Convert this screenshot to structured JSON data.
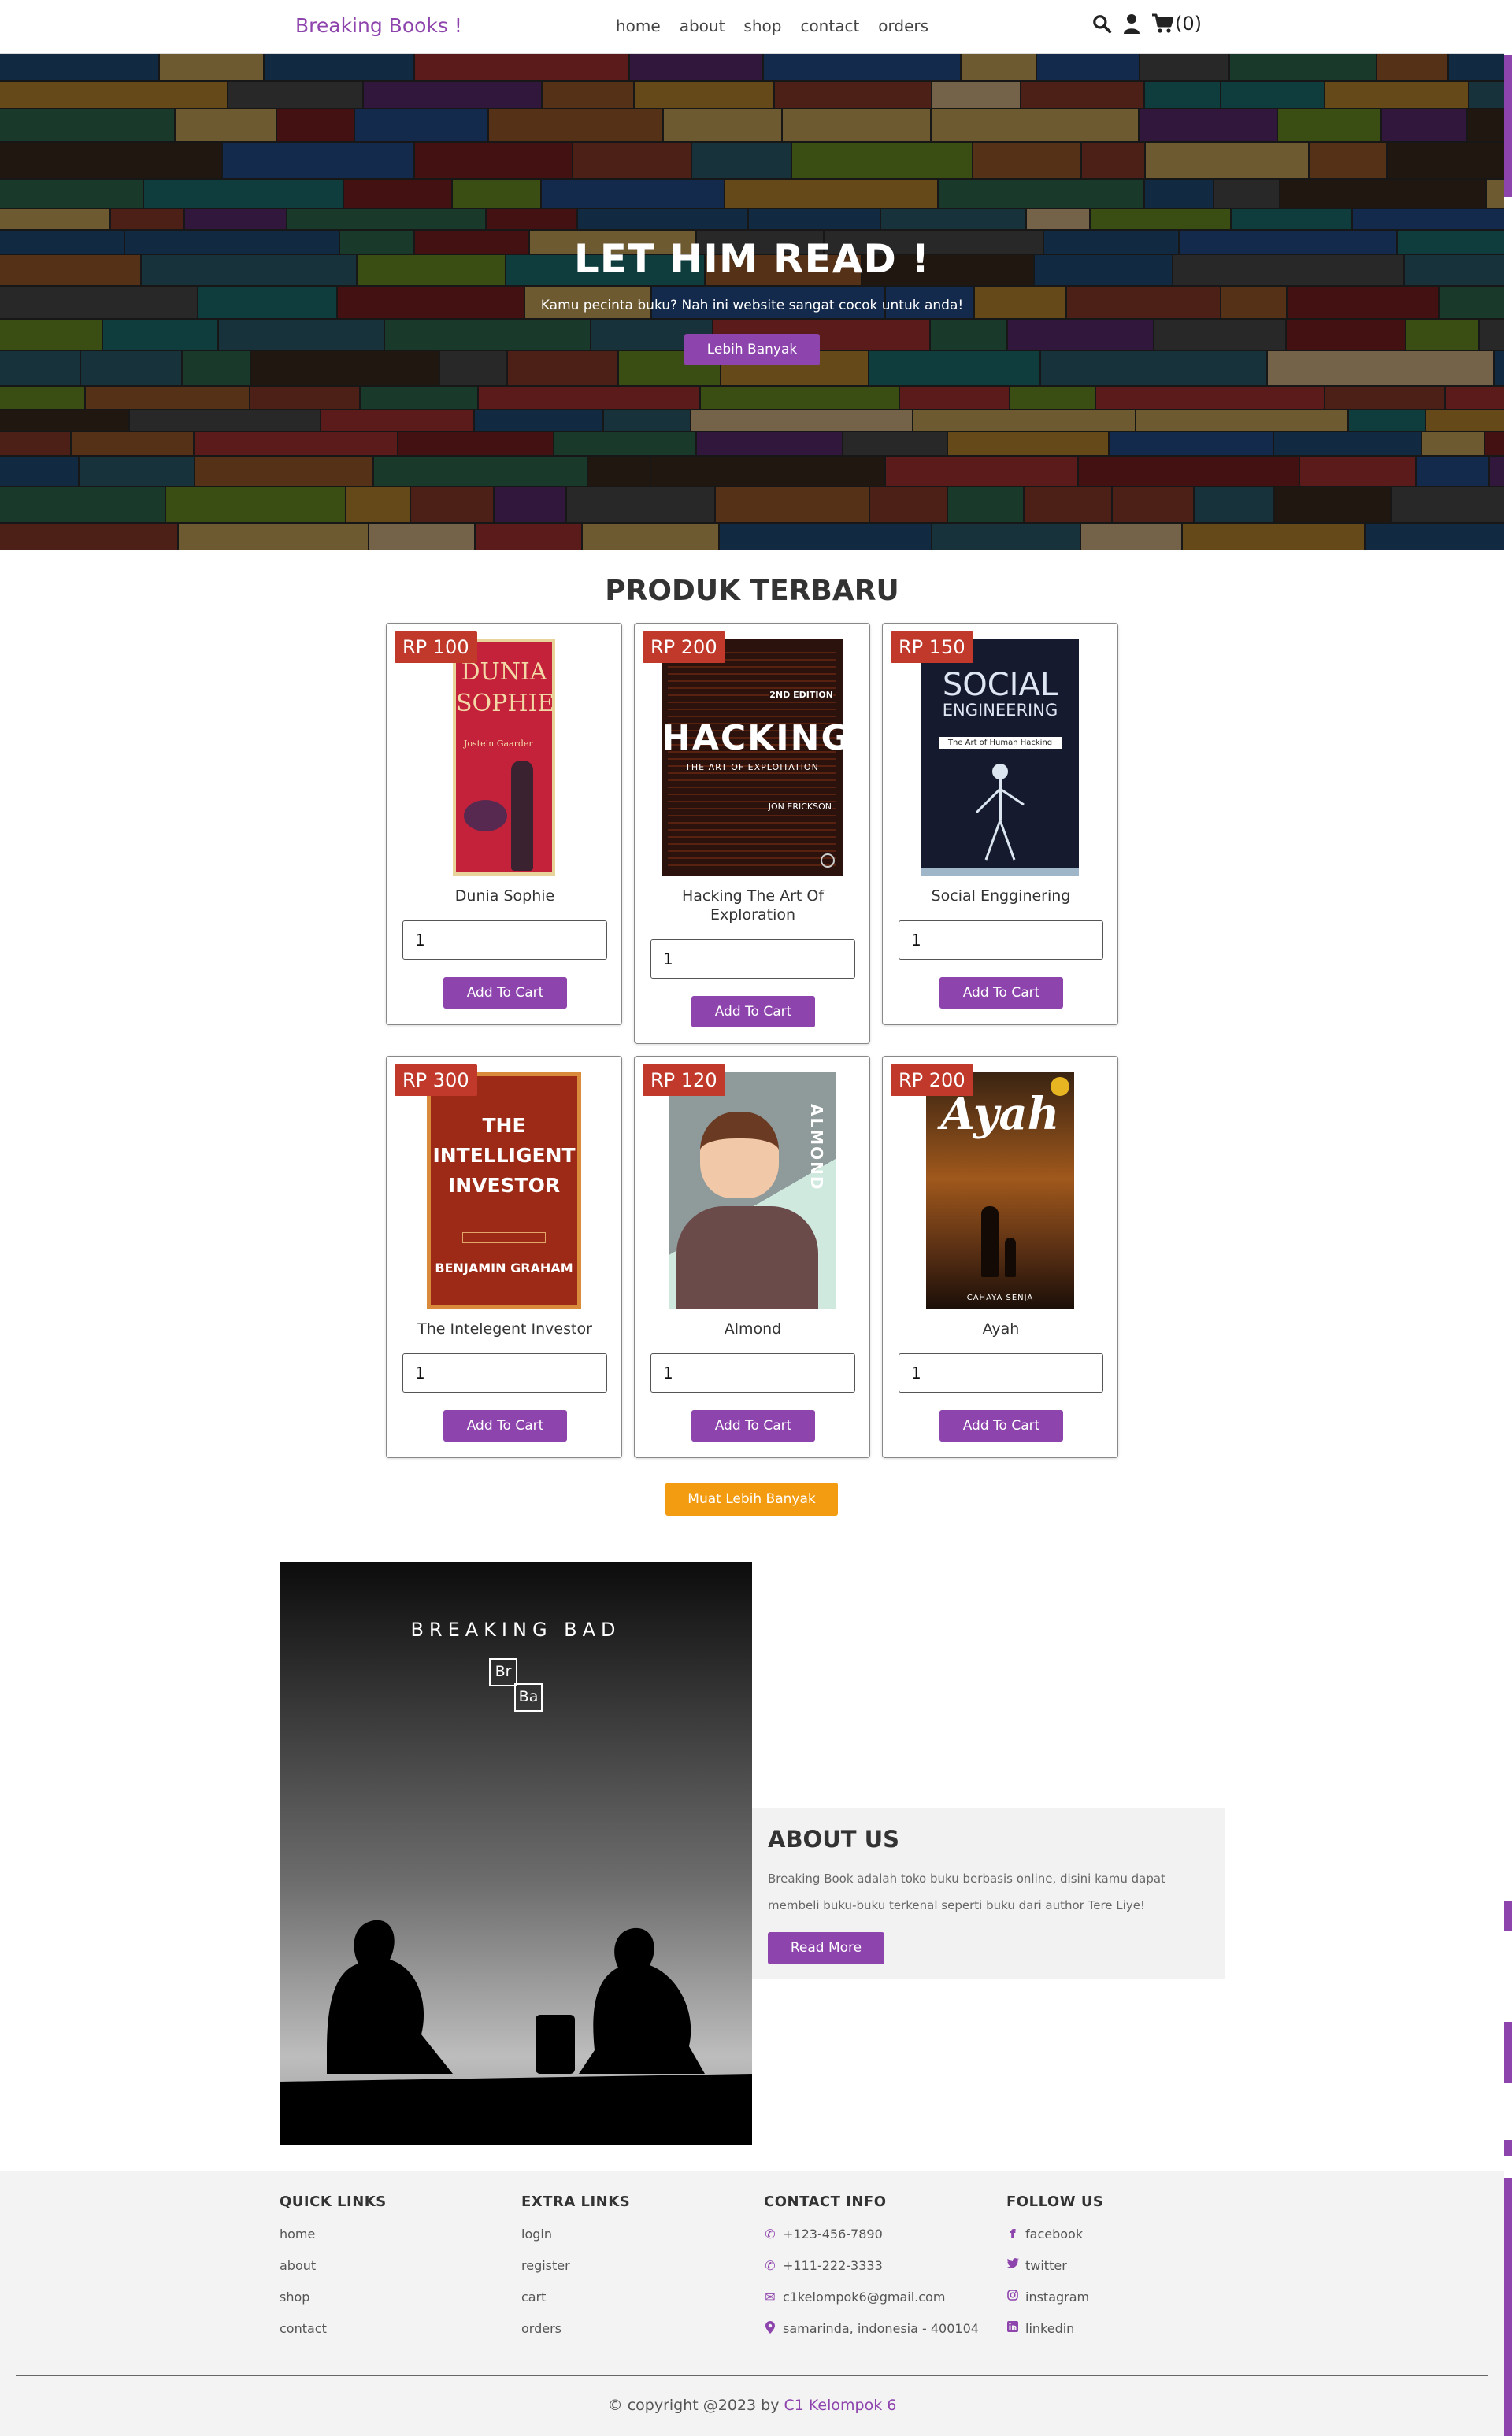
{
  "header": {
    "logo": "Breaking Books !",
    "nav": [
      "home",
      "about",
      "shop",
      "contact",
      "orders"
    ],
    "cart_count": "(0)"
  },
  "hero": {
    "title": "LET HIM READ !",
    "subtitle": "Kamu pecinta buku? Nah ini website sangat cocok untuk anda!",
    "button": "Lebih Banyak"
  },
  "products_section": {
    "title": "PRODUK TERBARU",
    "add_label": "Add To Cart",
    "items": [
      {
        "price": "RP 100",
        "name": "Dunia Sophie",
        "qty": "1",
        "cover": {
          "bg": "#c4213a",
          "lines": [
            "DUNIA",
            "SOPHIE"
          ],
          "sub": "Jostein Gaarder",
          "fg": "#f3d9a6"
        }
      },
      {
        "price": "RP 200",
        "name": "Hacking The Art Of Exploration",
        "qty": "1",
        "cover": {
          "bg": "#2b120c",
          "lines": [
            "HACKING"
          ],
          "sub": "THE ART OF EXPLOITATION",
          "edition": "2ND EDITION",
          "author": "JON ERICKSON",
          "fg": "#ffffff"
        }
      },
      {
        "price": "RP 150",
        "name": "Social Engginering",
        "qty": "1",
        "cover": {
          "bg": "#151a2e",
          "lines": [
            "SOCIAL",
            "ENGINEERING"
          ],
          "sub": "The Art of Human Hacking",
          "fg": "#dfe6f3"
        }
      },
      {
        "price": "RP 300",
        "name": "The Intelegent Investor",
        "qty": "1",
        "cover": {
          "bg": "#9c2a16",
          "lines": [
            "THE",
            "INTELLIGENT",
            "INVESTOR"
          ],
          "sub": "BENJAMIN GRAHAM",
          "fg": "#ffffff"
        }
      },
      {
        "price": "RP 120",
        "name": "Almond",
        "qty": "1",
        "cover": {
          "bg": "#cfe9df",
          "lines": [
            "ALMOND"
          ],
          "sub": "",
          "fg": "#ffffff"
        }
      },
      {
        "price": "RP 200",
        "name": "Ayah",
        "qty": "1",
        "cover": {
          "bg": "#2a1a0e",
          "lines": [
            "Ayah"
          ],
          "sub": "CAHAYA SENJA",
          "fg": "#ffffff"
        }
      }
    ],
    "load_more": "Muat Lebih Banyak"
  },
  "about": {
    "poster_title": "BREAKING BAD",
    "poster_el1": "Br",
    "poster_el2": "Ba",
    "title": "ABOUT US",
    "text": "Breaking Book adalah toko buku berbasis online, disini kamu dapat membeli buku-buku terkenal seperti buku dari author Tere Liye!",
    "button": "Read More"
  },
  "footer": {
    "quick_links": {
      "title": "QUICK LINKS",
      "items": [
        "home",
        "about",
        "shop",
        "contact"
      ]
    },
    "extra_links": {
      "title": "EXTRA LINKS",
      "items": [
        "login",
        "register",
        "cart",
        "orders"
      ]
    },
    "contact_info": {
      "title": "CONTACT INFO",
      "items": [
        "+123-456-7890",
        "+111-222-3333",
        "c1kelompok6@gmail.com",
        "samarinda, indonesia - 400104"
      ]
    },
    "follow_us": {
      "title": "FOLLOW US",
      "items": [
        "facebook",
        "twitter",
        "instagram",
        "linkedin"
      ]
    },
    "copyright_prefix": "© copyright @2023 by",
    "copyright_name": "C1 Kelompok 6"
  },
  "colors": {
    "accent": "#8e44ad",
    "price_badge": "#c0392b",
    "load_more": "#f39c12"
  }
}
